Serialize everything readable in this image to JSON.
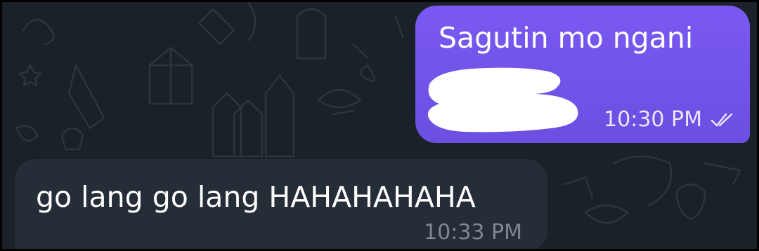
{
  "chat": {
    "messages": [
      {
        "direction": "outgoing",
        "text": "Sagutin mo ngani",
        "time": "10:30 PM",
        "status_icon": "double-check-icon",
        "has_redacted_region": true
      },
      {
        "direction": "incoming",
        "text": "go lang go lang HAHAHAHAHA",
        "time": "10:33 PM"
      }
    ]
  },
  "colors": {
    "background": "#1a2128",
    "outgoing_bubble": "#7257ea",
    "incoming_bubble": "#252d36",
    "text": "#ffffff",
    "incoming_time": "#7e8893"
  }
}
